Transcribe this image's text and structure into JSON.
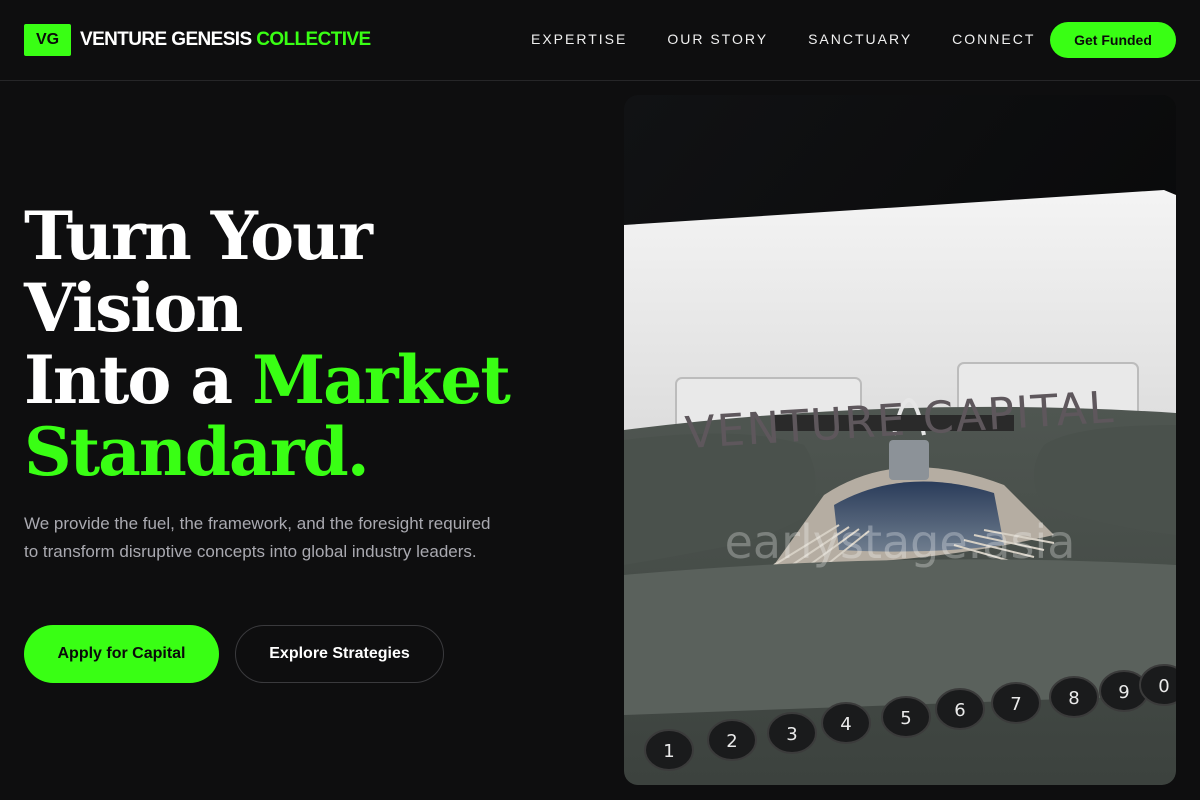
{
  "brand": {
    "badge": "VG",
    "name_main": "VENTURE GENESIS",
    "name_accent": "COLLECTIVE"
  },
  "nav": {
    "items": [
      {
        "label": "EXPERTISE"
      },
      {
        "label": "OUR STORY"
      },
      {
        "label": "SANCTUARY"
      },
      {
        "label": "CONNECT"
      }
    ],
    "cta": "Get Funded"
  },
  "hero": {
    "headline": {
      "line1": "Turn Your",
      "line2": "Vision",
      "line3_white": "Into a",
      "line3_green": "Market",
      "line4_green": "Standard."
    },
    "subtext": "We provide the fuel, the framework, and the foresight required to transform disruptive concepts into global industry leaders.",
    "primary_button": "Apply for Capital",
    "secondary_button": "Explore Strategies"
  },
  "image": {
    "paper_text": "VENTURE CAPITAL",
    "watermark": "earlystage.asia"
  },
  "colors": {
    "accent": "#39ff14",
    "background": "#0e0e0f",
    "muted_text": "#a9a9b0"
  }
}
